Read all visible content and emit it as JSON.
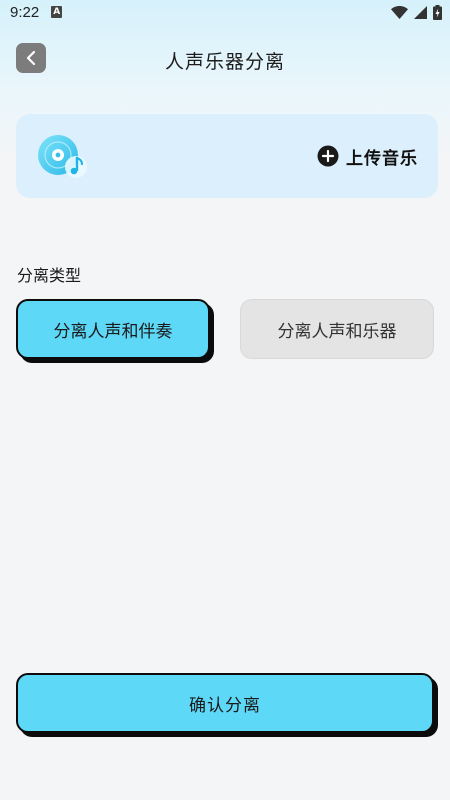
{
  "status_bar": {
    "time": "9:22",
    "notification_glyph": "A"
  },
  "header": {
    "title": "人声乐器分离"
  },
  "upload_card": {
    "upload_label": "上传音乐"
  },
  "separation": {
    "section_label": "分离类型",
    "options": [
      {
        "label": "分离人声和伴奏",
        "selected": true
      },
      {
        "label": "分离人声和乐器",
        "selected": false
      }
    ]
  },
  "footer": {
    "confirm_label": "确认分离"
  },
  "colors": {
    "accent": "#5ed8f7",
    "card_bg": "#dceffd",
    "unselected_bg": "#e4e4e4",
    "border_dark": "#0b0b0b"
  }
}
